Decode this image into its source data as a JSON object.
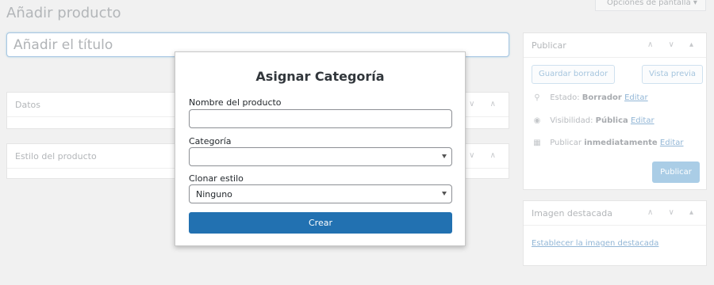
{
  "page": {
    "title": "Añadir producto",
    "screen_options": "Opciones de pantalla ▾",
    "title_placeholder": "Añadir el título"
  },
  "boxes": {
    "datos": "Datos",
    "estilo": "Estilo del producto",
    "arrows": "∨ ∧"
  },
  "publish": {
    "heading": "Publicar",
    "arrows": "∧ ∨ ▴",
    "save_draft": "Guardar borrador",
    "preview": "Vista previa",
    "status_label": "Estado:",
    "status_value": "Borrador",
    "visibility_label": "Visibilidad:",
    "visibility_value": "Pública",
    "schedule_label": "Publicar",
    "schedule_value": "inmediatamente",
    "edit": "Editar",
    "publish_button": "Publicar"
  },
  "featured": {
    "heading": "Imagen destacada",
    "arrows": "∧ ∨ ▴",
    "set_link": "Establecer la imagen destacada"
  },
  "modal": {
    "title": "Asignar Categoría",
    "name_label": "Nombre del producto",
    "name_value": "",
    "category_label": "Categoría",
    "category_value": "",
    "clone_label": "Clonar estilo",
    "clone_value": "Ninguno",
    "create_button": "Crear"
  }
}
